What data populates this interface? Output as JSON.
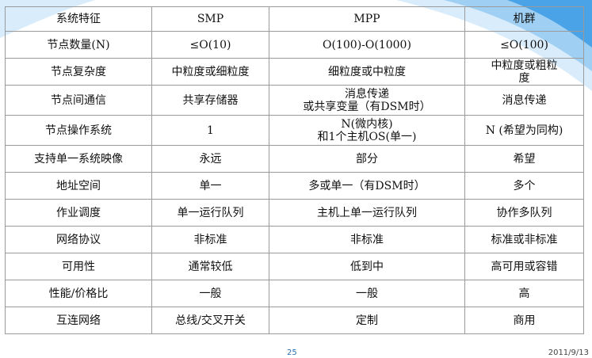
{
  "table": {
    "header": [
      "系统特征",
      "SMP",
      "MPP",
      "机群"
    ],
    "rows": [
      [
        "节点数量(N)",
        "≤O(10)",
        "O(100)-O(1000)",
        "≤O(100)"
      ],
      [
        "节点复杂度",
        "中粒度或细粒度",
        "细粒度或中粒度",
        "中粒度或粗粒\n度"
      ],
      [
        "节点间通信",
        "共享存储器",
        "消息传递\n或共享变量（有DSM时）",
        "消息传递"
      ],
      [
        "节点操作系统",
        "1",
        "N(微内核)\n和1个主机OS(单一)",
        "N (希望为同构)"
      ],
      [
        "支持单一系统映像",
        "永远",
        "部分",
        "希望"
      ],
      [
        "地址空间",
        "单一",
        "多或单一（有DSM时）",
        "多个"
      ],
      [
        "作业调度",
        "单一运行队列",
        "主机上单一运行队列",
        "协作多队列"
      ],
      [
        "网络协议",
        "非标准",
        "非标准",
        "标准或非标准"
      ],
      [
        "可用性",
        "通常较低",
        "低到中",
        "高可用或容错"
      ],
      [
        "性能/价格比",
        "一般",
        "一般",
        "高"
      ],
      [
        "互连网络",
        "总线/交叉开关",
        "定制",
        "商用"
      ]
    ]
  },
  "footer": {
    "page_number": "25",
    "date": "2011/9/13"
  },
  "colors": {
    "wave_light": "#d8ecfb",
    "wave_mid": "#9fd0f3",
    "wave_dark": "#4aa3e6",
    "page_number": "#2a6fb2"
  }
}
